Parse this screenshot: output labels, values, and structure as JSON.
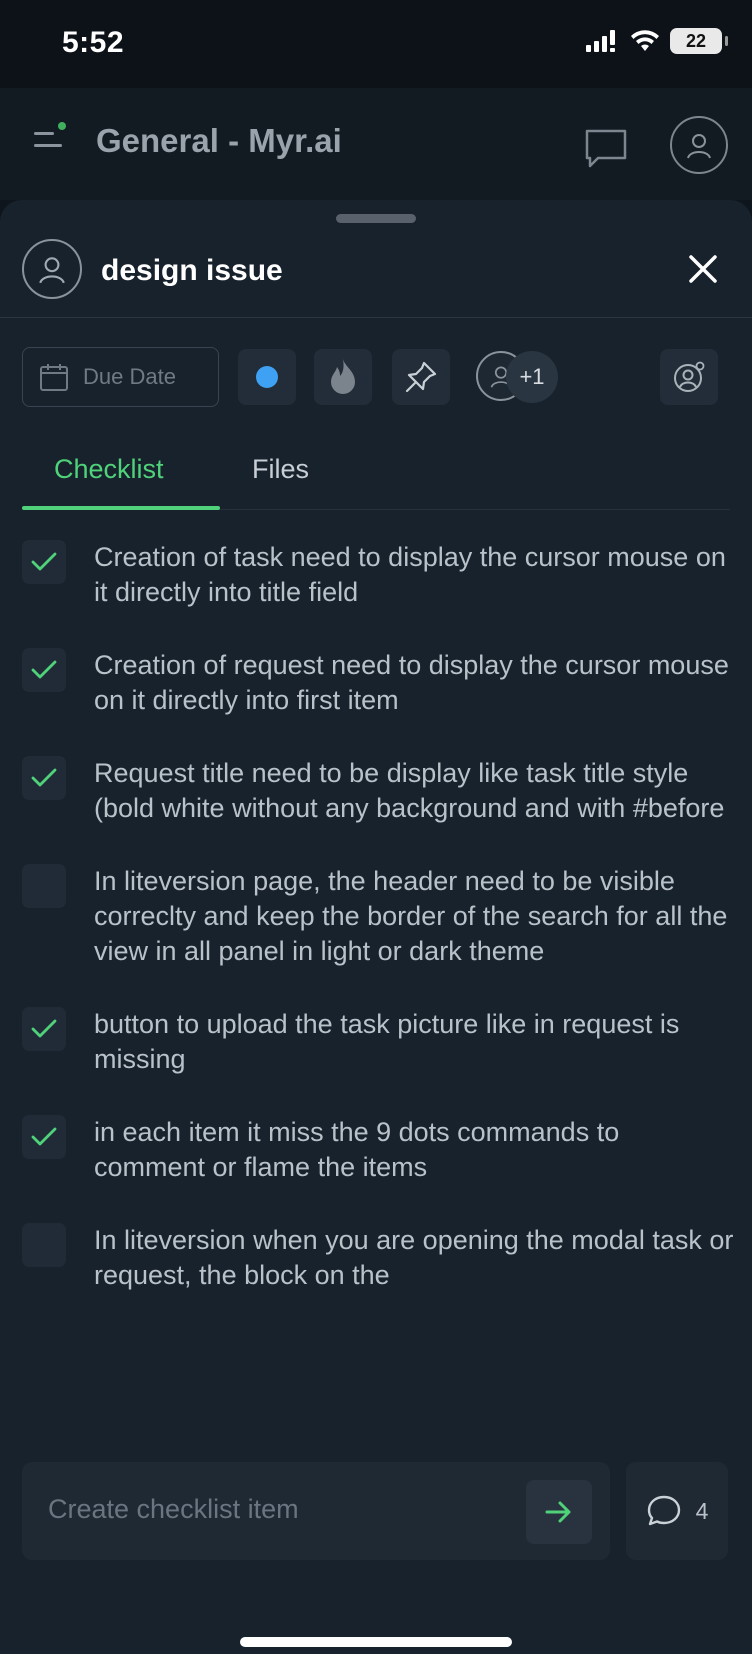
{
  "status_bar": {
    "time": "5:52",
    "battery": "22"
  },
  "app_header": {
    "title": "General - Myr.ai"
  },
  "task": {
    "title": "design issue",
    "due_date_label": "Due Date",
    "assignee_more": "+1",
    "status_color": "#3fa1f3"
  },
  "tabs": [
    {
      "label": "Checklist",
      "active": true
    },
    {
      "label": "Files",
      "active": false
    }
  ],
  "checklist": [
    {
      "text": "Creation of task need to display the cursor mouse on it directly into title field",
      "checked": true
    },
    {
      "text": "Creation of request need to display the cursor mouse on it directly into first item",
      "checked": true
    },
    {
      "text": "Request title need to be display like task title style (bold white without any background and with #before",
      "checked": true
    },
    {
      "text": "In liteversion page, the header need to be visible correclty and keep the border of the search for all the view in all panel in light or dark theme",
      "checked": false
    },
    {
      "text": "button to upload the task picture like in request is missing",
      "checked": true
    },
    {
      "text": "in each item it miss the 9 dots commands to comment or flame the items",
      "checked": true
    },
    {
      "text": "In liteversion when you are opening the modal task or request, the block on the",
      "checked": false
    }
  ],
  "composer": {
    "placeholder": "Create checklist item"
  },
  "comments": {
    "count": "4"
  },
  "colors": {
    "accent": "#4fd27a",
    "background": "#18222d"
  },
  "icons": [
    "menu-icon",
    "chat-icon",
    "user-icon",
    "close-icon",
    "calendar-icon",
    "flame-icon",
    "pin-icon",
    "user-settings-icon",
    "check-icon",
    "arrow-right-icon",
    "comment-icon"
  ]
}
